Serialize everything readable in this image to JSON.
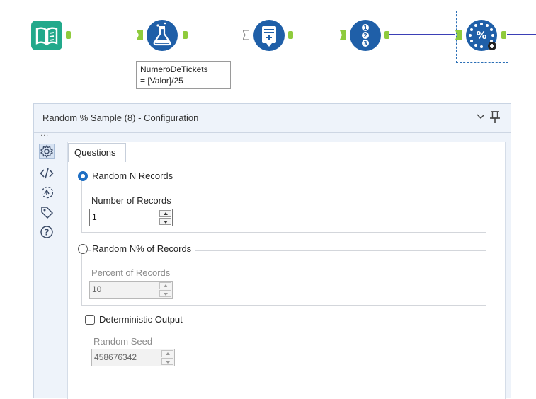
{
  "canvas": {
    "tools": [
      {
        "name": "input-data-tool",
        "icon": "book-icon",
        "color": "#22a98b"
      },
      {
        "name": "formula-tool",
        "icon": "flask-icon",
        "color": "#1f5fa8"
      },
      {
        "name": "summarize-tool",
        "icon": "summarize-icon",
        "color": "#1f5fa8"
      },
      {
        "name": "record-id-tool",
        "icon": "numbered-list-icon",
        "color": "#1f5fa8"
      },
      {
        "name": "random-sample-tool",
        "icon": "percent-dots-icon",
        "color": "#1f5fa8"
      }
    ],
    "annotation": {
      "line1": "NumeroDeTickets",
      "line2": "= [Valor]/25"
    },
    "connection_color": "#8e8e8e",
    "selected_connection_color": "#3b3fb6",
    "anchor_color": "#8fcb3c"
  },
  "panel": {
    "title": "Random % Sample (8) - Configuration",
    "dots": "...",
    "side_icons": [
      "gear-icon",
      "code-icon",
      "arrow-circle-icon",
      "tag-icon",
      "help-icon"
    ],
    "tab": "Questions",
    "option_n_records": {
      "label": "Random N Records",
      "selected": true,
      "field_label": "Number of Records",
      "value": "1"
    },
    "option_percent": {
      "label": "Random N% of Records",
      "selected": false,
      "field_label": "Percent of Records",
      "value": "10"
    },
    "deterministic": {
      "label": "Deterministic Output",
      "checked": false,
      "field_label": "Random Seed",
      "value": "458676342"
    },
    "accent_color": "#1f6fc4"
  }
}
